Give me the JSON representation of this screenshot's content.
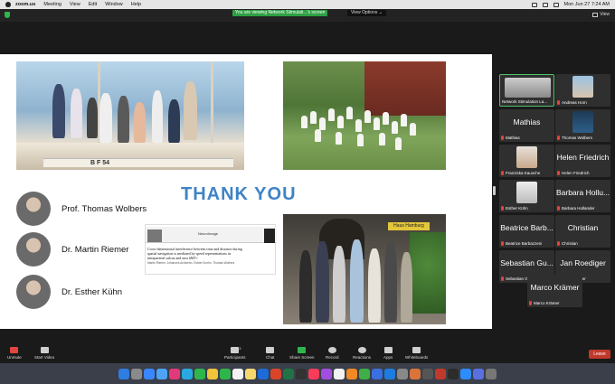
{
  "menubar": {
    "app_name": "zoom.us",
    "items": [
      "Meeting",
      "View",
      "Edit",
      "Window",
      "Help"
    ],
    "datetime": "Mon Jun 27  7:24 AM"
  },
  "zoom_top": {
    "banner": "You are viewing Network Stimulati...'s screen",
    "view_options": "View Options ⌄",
    "view_button": "View"
  },
  "slide": {
    "thank_you": "THANK YOU",
    "boat_sail_letters": "B  F  54",
    "group_sign": "Haus Hamburg",
    "acknowledgements": [
      {
        "name": "Prof. Thomas Wolbers"
      },
      {
        "name": "Dr. Martin Riemer"
      },
      {
        "name": "Dr. Esther Kühn"
      }
    ],
    "paper": {
      "journal": "NeuroImage",
      "title": "Cross-dimensional interference between time and distance during spatial navigation is mediated by speed representations in intraparietal sulcus and area hMT+",
      "authors": "Martin Riemer, Johannes Achtzehn, Esther Kuehn, Thomas Wolbers"
    }
  },
  "participants": [
    {
      "big": "",
      "label": "Network Stimulation La...",
      "type": "screen",
      "active": true
    },
    {
      "big": "",
      "label": "Andreas Horn",
      "type": "video"
    },
    {
      "big": "Mathias",
      "label": "Mathias",
      "type": "name"
    },
    {
      "big": "",
      "label": "Thomas Wolbers",
      "type": "video"
    },
    {
      "big": "",
      "label": "Franziska Kausche",
      "type": "video"
    },
    {
      "big": "Helen Friedrich",
      "label": "Helen Friedrich",
      "type": "name"
    },
    {
      "big": "",
      "label": "Esther Kühn",
      "type": "video"
    },
    {
      "big": "Barbara Hollu...",
      "label": "Barbara Hollander",
      "type": "name"
    },
    {
      "big": "Beatrice Barb...",
      "label": "Beatrice Barbazzeni",
      "type": "name"
    },
    {
      "big": "Christian",
      "label": "Christian",
      "type": "name"
    },
    {
      "big": "Sebastian Gu...",
      "label": "Sebastian Gugel",
      "type": "name"
    },
    {
      "big": "Jan Roediger",
      "label": "Jan Roediger",
      "type": "name"
    },
    {
      "big": "Marco Krämer",
      "label": "Marco Krämer",
      "type": "name"
    }
  ],
  "toolbar": {
    "unmute": "Unmute",
    "start_video": "Start Video",
    "participants": "Participants",
    "participant_count": "13",
    "chat": "Chat",
    "share_screen": "Share Screen",
    "record": "Record",
    "reactions": "Reactions",
    "apps": "Apps",
    "whiteboards": "Whiteboards",
    "leave": "Leave"
  },
  "colors": {
    "thank_you": "#3f83c5",
    "banner_green": "#2ea043",
    "leave_red": "#c0392b",
    "active_border": "#4fc46c"
  }
}
